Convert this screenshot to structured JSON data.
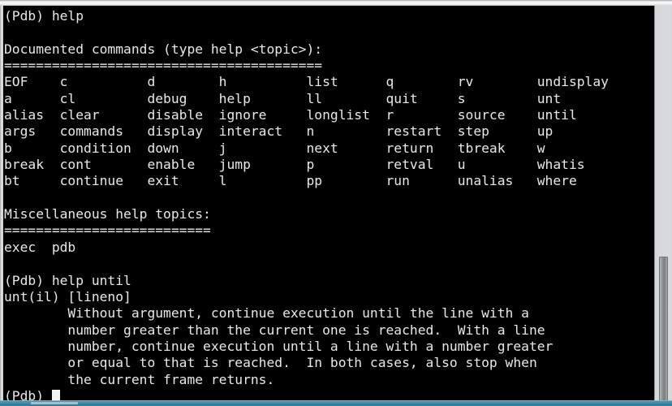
{
  "window": {
    "background": "#000000",
    "foreground": "#e8e8e8",
    "accent_bottom": "#4a8fa8",
    "chrome": "#d5d7d8"
  },
  "terminal": {
    "prompt": "(Pdb)",
    "command_entered": "help",
    "second_command_entered": "help until",
    "documented_header": "Documented commands (type help <topic>):",
    "documented_rule": "========================================",
    "misc_header": "Miscellaneous help topics:",
    "misc_rule": "==========================",
    "misc_topics": [
      "exec",
      "pdb"
    ],
    "command_columns": [
      [
        "EOF",
        "a",
        "alias",
        "args",
        "b",
        "break",
        "bt"
      ],
      [
        "c",
        "cl",
        "clear",
        "commands",
        "condition",
        "cont",
        "continue"
      ],
      [
        "d",
        "debug",
        "disable",
        "display",
        "down",
        "enable",
        "exit"
      ],
      [
        "h",
        "help",
        "ignore",
        "interact",
        "j",
        "jump",
        "l"
      ],
      [
        "list",
        "ll",
        "longlist",
        "n",
        "next",
        "p",
        "pp"
      ],
      [
        "q",
        "quit",
        "r",
        "restart",
        "return",
        "retval",
        "run"
      ],
      [
        "rv",
        "s",
        "source",
        "step",
        "tbreak",
        "u",
        "unalias"
      ],
      [
        "undisplay",
        "unt",
        "until",
        "up",
        "w",
        "whatis",
        "where"
      ]
    ],
    "help_until": {
      "signature": "unt(il) [lineno]",
      "body_lines": [
        "Without argument, continue execution until the line with a",
        "number greater than the current one is reached.  With a line",
        "number, continue execution until a line with a number greater",
        "or equal to that is reached.  In both cases, also stop when",
        "the current frame returns."
      ]
    },
    "lines": [
      "(Pdb) help",
      "",
      "Documented commands (type help <topic>):",
      "========================================",
      "EOF    c          d        h          list      q        rv        undisplay",
      "a      cl         debug    help       ll        quit     s         unt",
      "alias  clear      disable  ignore     longlist  r        source    until",
      "args   commands   display  interact   n         restart  step      up",
      "b      condition  down     j          next      return   tbreak    w",
      "break  cont       enable   jump       p         retval   u         whatis",
      "bt     continue   exit     l          pp        run      unalias   where",
      "",
      "Miscellaneous help topics:",
      "==========================",
      "exec  pdb",
      "",
      "(Pdb) help until",
      "unt(il) [lineno]",
      "        Without argument, continue execution until the line with a",
      "        number greater than the current one is reached.  With a line",
      "        number, continue execution until a line with a number greater",
      "        or equal to that is reached.  In both cases, also stop when",
      "        the current frame returns."
    ],
    "final_prompt": "(Pdb) ",
    "cursor_visible": true
  },
  "scrollbar": {
    "orientation": "vertical",
    "thumb_top_pct": 63,
    "thumb_height_pct": 37
  }
}
